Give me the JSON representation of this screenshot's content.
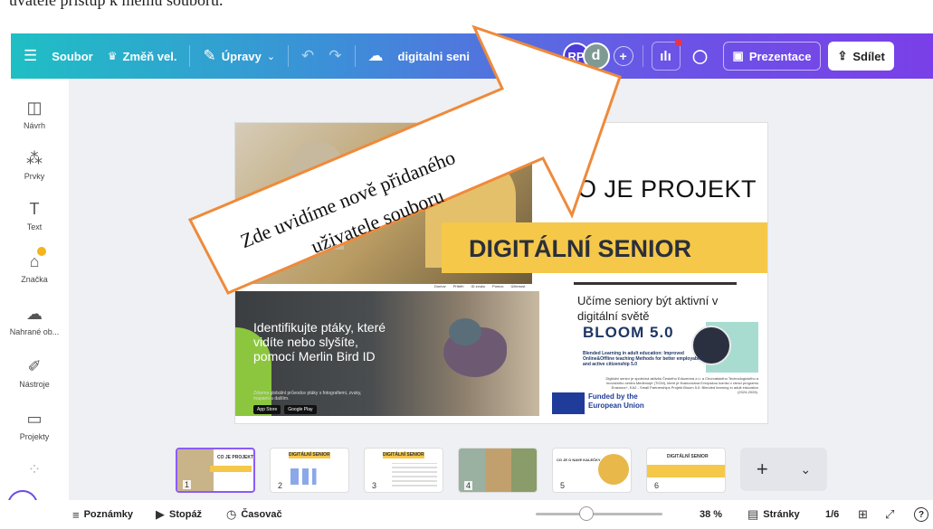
{
  "top_caption": "uvatelé přístup k mému souboru.",
  "toolbar": {
    "menu_icon": "hamburger-icon",
    "file_label": "Soubor",
    "resize_label": "Změň vel.",
    "edit_label": "Úpravy",
    "doc_title": "digitalni seni",
    "doc_title_suffix": "tat...",
    "avatar_rp": "RP",
    "avatar_d": "d",
    "present_label": "Prezentace",
    "share_label": "Sdílet",
    "gradient_colors": [
      "#1fbfc4",
      "#3c8fd8",
      "#6a55e6",
      "#7a3fe8"
    ]
  },
  "sidebar": {
    "items": [
      {
        "label": "Návrh",
        "icon": "layout-icon"
      },
      {
        "label": "Prvky",
        "icon": "elements-icon"
      },
      {
        "label": "Text",
        "icon": "text-icon"
      },
      {
        "label": "Značka",
        "icon": "brand-icon"
      },
      {
        "label": "Nahrané ob...",
        "icon": "upload-icon"
      },
      {
        "label": "Nástroje",
        "icon": "tools-icon"
      },
      {
        "label": "Projekty",
        "icon": "folder-icon"
      }
    ]
  },
  "slide": {
    "title_line1": "O JE PROJEKT",
    "title_line2": "DIGITÁLNÍ SENIOR",
    "nav_items": [
      "Domov",
      "Příběh",
      "ID zvuku",
      "Pomoc",
      "Účtenost"
    ],
    "bird_text": "Identifikujte ptáky, které vidíte nebo slyšíte, pomocí Merlin Bird ID",
    "bird_small": "Zdarma globální průvodce ptáky s fotografiemi, zvuky, mapami a dalším.",
    "store1": "App Store",
    "store2": "Google Play",
    "subtitle": "Učíme seniory být aktivní v digitální světě",
    "bloom_title": "BLOOM 5.0",
    "bloom_sub": "Blended Learning in adult education: Improved Online&Offline teaching Methods for better employability and active citizenship 5.0",
    "bloom_tiny": "Digitální senior je společná aktivita Českého Eduzentra z.ú. a Chorvatského Technologického a inovačního centra Medimurje (TICM), které je financována Evropskou komisí v rámci programu Erasmus+, KA2 - Small Partnerships Projekt Bloom 5.0: Blended learning in adult education (2024-2026).",
    "eu_text": "Funded by the European Union"
  },
  "callout": {
    "line1": "Zde uvidíme nově přidaného",
    "line2": "uživatele souboru"
  },
  "thumbnails": [
    {
      "num": "1",
      "title": "CO JE PROJEKT"
    },
    {
      "num": "2",
      "title": "DIGITÁLNÍ SENIOR"
    },
    {
      "num": "3",
      "title": "DIGITÁLNÍ SENIOR"
    },
    {
      "num": "4",
      "title": ""
    },
    {
      "num": "5",
      "title": "CO JE O NAVE KALEČKY"
    },
    {
      "num": "6",
      "title": "DIGITÁLNÍ SENIOR"
    }
  ],
  "bottombar": {
    "notes_label": "Poznámky",
    "timer_label": "Stopáž",
    "clock_label": "Časovač",
    "zoom": "38 %",
    "pages_label": "Stránky",
    "page_counter": "1/6",
    "help": "?"
  }
}
